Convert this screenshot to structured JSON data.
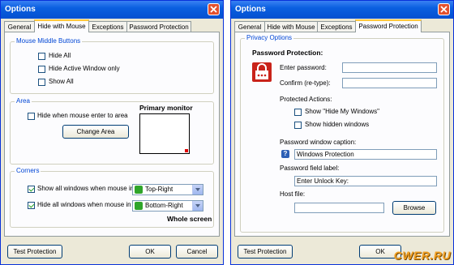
{
  "left_window": {
    "title": "Options",
    "tabs": [
      "General",
      "Hide with Mouse",
      "Exceptions",
      "Password Protection"
    ],
    "active_tab": 1,
    "mouse_middle": {
      "label": "Mouse Middle Buttons",
      "options": [
        {
          "label": "Hide All",
          "checked": false
        },
        {
          "label": "Hide Active Window only",
          "checked": false
        },
        {
          "label": "Show All",
          "checked": false
        }
      ]
    },
    "area": {
      "label": "Area",
      "hide_checkbox_label": "Hide when mouse enter to area",
      "change_button": "Change Area",
      "monitor_label": "Primary monitor"
    },
    "corners": {
      "label": "Corners",
      "rows": [
        {
          "label": "Show all windows when mouse in",
          "checked": true,
          "value": "Top-Right"
        },
        {
          "label": "Hide all windows when mouse in",
          "checked": true,
          "value": "Bottom-Right"
        }
      ],
      "whole_screen": "Whole screen"
    },
    "footer": {
      "test": "Test Protection",
      "ok": "OK",
      "cancel": "Cancel"
    }
  },
  "right_window": {
    "title": "Options",
    "tabs": [
      "General",
      "Hide with Mouse",
      "Exceptions",
      "Password Protection"
    ],
    "active_tab": 3,
    "privacy_label": "Privacy Options",
    "password_heading": "Password Protection:",
    "enter_password_label": "Enter password:",
    "confirm_label": "Confirm (re-type):",
    "protected_actions_label": "Protected Actions:",
    "protected_actions": [
      {
        "label": "Show \"Hide My Windows\"",
        "checked": false
      },
      {
        "label": "Show hidden windows",
        "checked": false
      }
    ],
    "caption_label": "Password window caption:",
    "caption_value": "Windows Protection",
    "field_label_label": "Password field label:",
    "field_label_value": "Enter Unlock Key:",
    "host_file_label": "Host file:",
    "host_file_value": "",
    "browse_button": "Browse",
    "footer": {
      "test": "Test Protection",
      "ok": "OK"
    }
  },
  "watermark": "CWER.RU",
  "colors": {
    "titlebar": "#0a5fe0",
    "group_label": "#0046d5",
    "close": "#e3512e"
  }
}
